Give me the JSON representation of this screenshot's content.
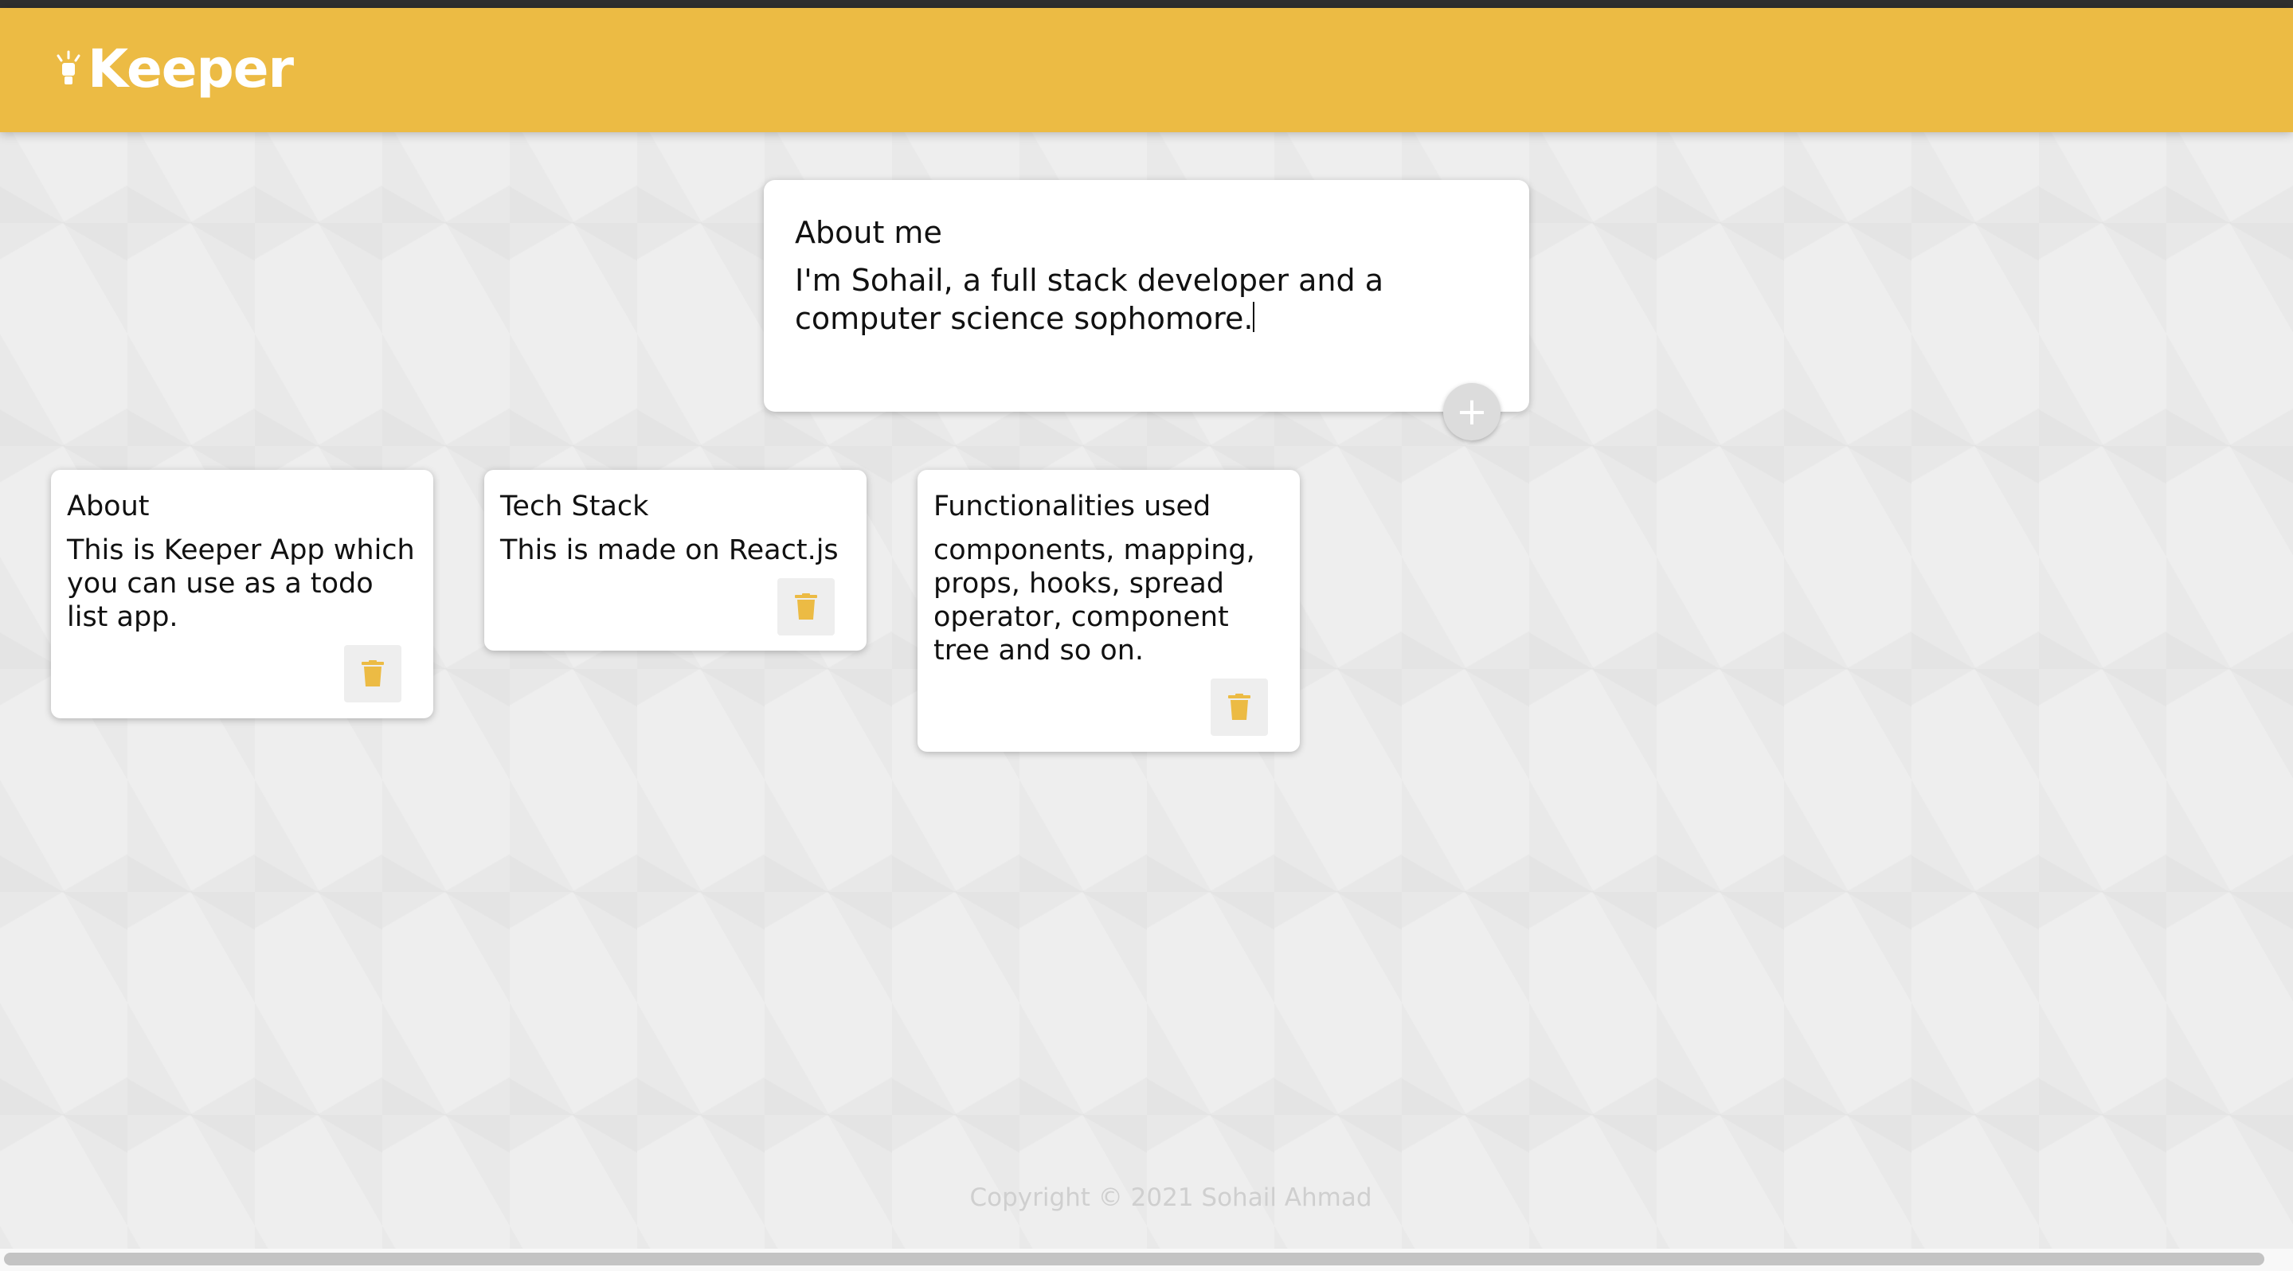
{
  "header": {
    "title": "Keeper",
    "logo_icon": "lightbulb-icon",
    "background": "#ecbb44"
  },
  "create_note": {
    "title": "About me",
    "content": "I'm Sohail, a full stack developer and a computer science sophomore.",
    "add_icon": "plus-icon"
  },
  "notes": [
    {
      "title": "About",
      "content": "This is Keeper App which you can use as a todo list app.",
      "delete_icon": "trash-icon"
    },
    {
      "title": "Tech Stack",
      "content": "This is made on React.js",
      "delete_icon": "trash-icon"
    },
    {
      "title": "Functionalities used",
      "content": "components, mapping, props, hooks, spread operator, component tree and so on.",
      "delete_icon": "trash-icon"
    }
  ],
  "footer": {
    "text": "Copyright © 2021 Sohail Ahmad"
  },
  "colors": {
    "accent": "#ecbb44",
    "card": "#ffffff",
    "footer_text": "#cfcfcf"
  }
}
